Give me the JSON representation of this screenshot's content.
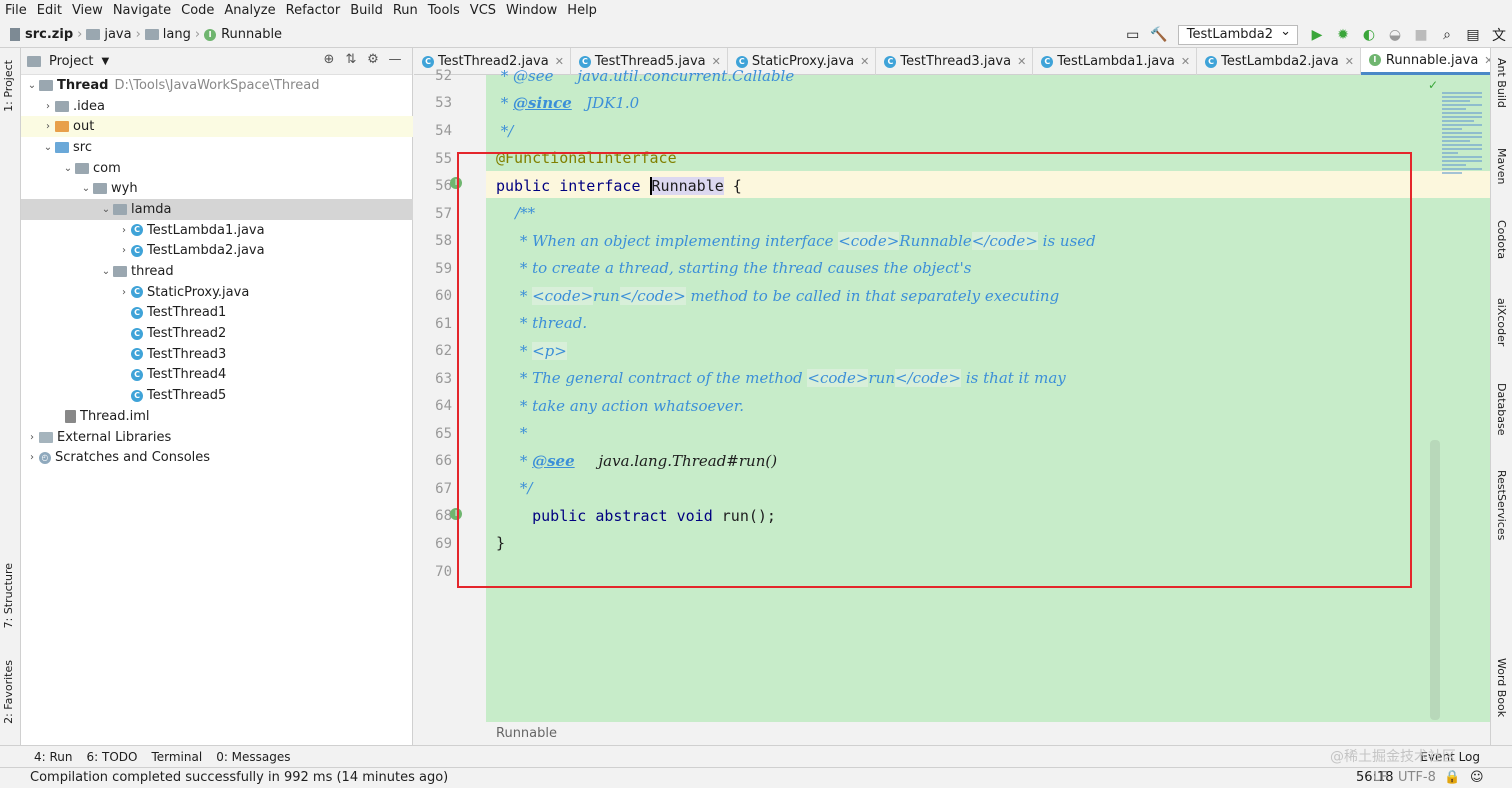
{
  "menu": [
    "File",
    "Edit",
    "View",
    "Navigate",
    "Code",
    "Analyze",
    "Refactor",
    "Build",
    "Run",
    "Tools",
    "VCS",
    "Window",
    "Help"
  ],
  "breadcrumb": {
    "zip": "src.zip",
    "java": "java",
    "lang": "lang",
    "file": "Runnable"
  },
  "run_config": "TestLambda2",
  "left_tabs": {
    "project": "1: Project",
    "structure": "7: Structure",
    "favorites": "2: Favorites"
  },
  "project": {
    "title": "Project",
    "root_name": "Thread",
    "root_path": "D:\\Tools\\JavaWorkSpace\\Thread",
    "items": [
      {
        "label": ".idea"
      },
      {
        "label": "out"
      },
      {
        "label": "src"
      },
      {
        "label": "com"
      },
      {
        "label": "wyh"
      },
      {
        "label": "lamda"
      },
      {
        "label": "TestLambda1.java"
      },
      {
        "label": "TestLambda2.java"
      },
      {
        "label": "thread"
      },
      {
        "label": "StaticProxy.java"
      },
      {
        "label": "TestThread1"
      },
      {
        "label": "TestThread2"
      },
      {
        "label": "TestThread3"
      },
      {
        "label": "TestThread4"
      },
      {
        "label": "TestThread5"
      },
      {
        "label": "Thread.iml"
      },
      {
        "label": "External Libraries"
      },
      {
        "label": "Scratches and Consoles"
      }
    ]
  },
  "tabs": [
    "TestThread2.java",
    "TestThread5.java",
    "StaticProxy.java",
    "TestThread3.java",
    "TestLambda1.java",
    "TestLambda2.java",
    "Runnable.java"
  ],
  "line_numbers": [
    "52",
    "53",
    "54",
    "55",
    "56",
    "57",
    "58",
    "59",
    "60",
    "61",
    "62",
    "63",
    "64",
    "65",
    "66",
    "67",
    "68",
    "69",
    "70"
  ],
  "code": {
    "l52": " * @see     java.util.concurrent.Callable",
    "l53_tag": "@since",
    "l53_rest": "   JDK1.0",
    "l54": " */",
    "l55": "@FunctionalInterface",
    "l56_kw": "public interface ",
    "l56_name": "Runnable",
    "l56_rest": " {",
    "l57": "    /**",
    "l58_a": "     * When an object implementing interface ",
    "l58_b": "<code>",
    "l58_c": "Runnable",
    "l58_d": "</code>",
    "l58_e": " is used",
    "l59": "     * to create a thread, starting the thread causes the object's",
    "l60_a": "     * ",
    "l60_b": "<code>",
    "l60_c": "run",
    "l60_d": "</code>",
    "l60_e": " method to be called in that separately executing",
    "l61": "     * thread.",
    "l62_a": "     * ",
    "l62_b": "<p>",
    "l63_a": "     * The general contract of the method ",
    "l63_b": "<code>",
    "l63_c": "run",
    "l63_d": "</code>",
    "l63_e": " is that it may",
    "l64": "     * take any action whatsoever.",
    "l65": "     *",
    "l66_a": "     * ",
    "l66_tag": "@see",
    "l66_rest": "     java.lang.Thread#run()",
    "l67": "     */",
    "l68_kw": "    public abstract void",
    "l68_rest": " run();",
    "l69": "}",
    "l70": ""
  },
  "editor_breadcrumb": "Runnable",
  "right_tabs": [
    "Ant Build",
    "Maven",
    "Codota",
    "aiXcoder",
    "Database",
    "RestServices",
    "Word Book"
  ],
  "toolwindows": [
    "4: Run",
    "6: TODO",
    "Terminal",
    "0: Messages"
  ],
  "event_log": "Event Log",
  "status": {
    "message": "Compilation completed successfully in 992 ms (14 minutes ago)",
    "position": "56:18",
    "line_sep": "LF",
    "encoding": "UTF-8"
  },
  "watermark": "@稀土掘金技术社区"
}
